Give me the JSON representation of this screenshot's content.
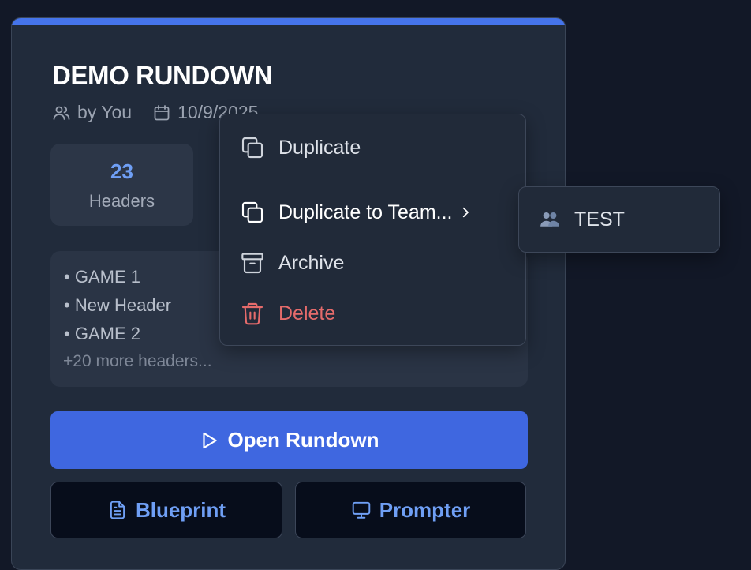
{
  "card": {
    "title": "DEMO RUNDOWN",
    "author": "by You",
    "date": "10/9/2025",
    "stat": {
      "value": "23",
      "label": "Headers"
    },
    "headers": [
      "GAME 1",
      "New Header",
      "GAME 2"
    ],
    "more_headers": "+20 more headers...",
    "open_label": "Open Rundown",
    "blueprint_label": "Blueprint",
    "prompter_label": "Prompter"
  },
  "menu": {
    "items": [
      {
        "label": "Duplicate",
        "icon": "copy-icon"
      },
      {
        "label": "Duplicate to Team...",
        "icon": "copy-icon"
      },
      {
        "label": "Archive",
        "icon": "archive-icon"
      },
      {
        "label": "Delete",
        "icon": "trash-icon"
      }
    ]
  },
  "submenu": {
    "items": [
      {
        "label": "TEST",
        "icon": "team-icon"
      }
    ]
  },
  "colors": {
    "accent": "#4574eb",
    "danger": "#e56b6b",
    "stat_value": "#6f9ff5"
  }
}
